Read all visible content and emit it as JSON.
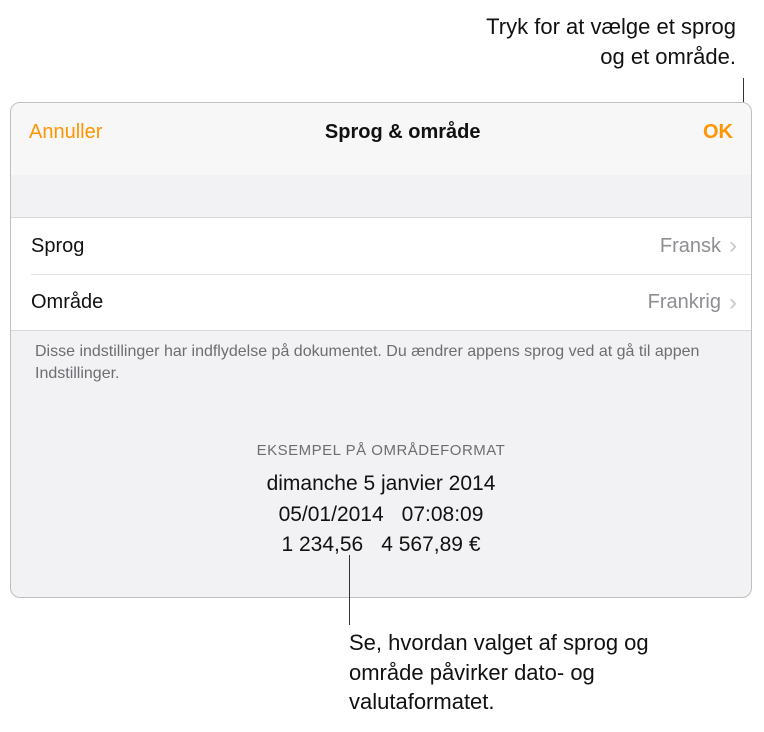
{
  "callouts": {
    "top": "Tryk for at vælge et sprog\nog et område.",
    "bottom": "Se, hvordan valget af sprog og område påvirker dato- og valutaformatet."
  },
  "panel": {
    "header": {
      "cancel": "Annuller",
      "title": "Sprog & område",
      "ok": "OK"
    },
    "rows": {
      "language": {
        "label": "Sprog",
        "value": "Fransk"
      },
      "region": {
        "label": "Område",
        "value": "Frankrig"
      }
    },
    "footer": "Disse indstillinger har indflydelse på dokumentet. Du ændrer appens sprog ved at gå til appen Indstillinger.",
    "example": {
      "header": "EKSEMPEL PÅ OMRÅDEFORMAT",
      "line1": "dimanche 5 janvier 2014",
      "line2a": "05/01/2014",
      "line2b": "07:08:09",
      "line3a": "1 234,56",
      "line3b": "4 567,89 €"
    }
  }
}
